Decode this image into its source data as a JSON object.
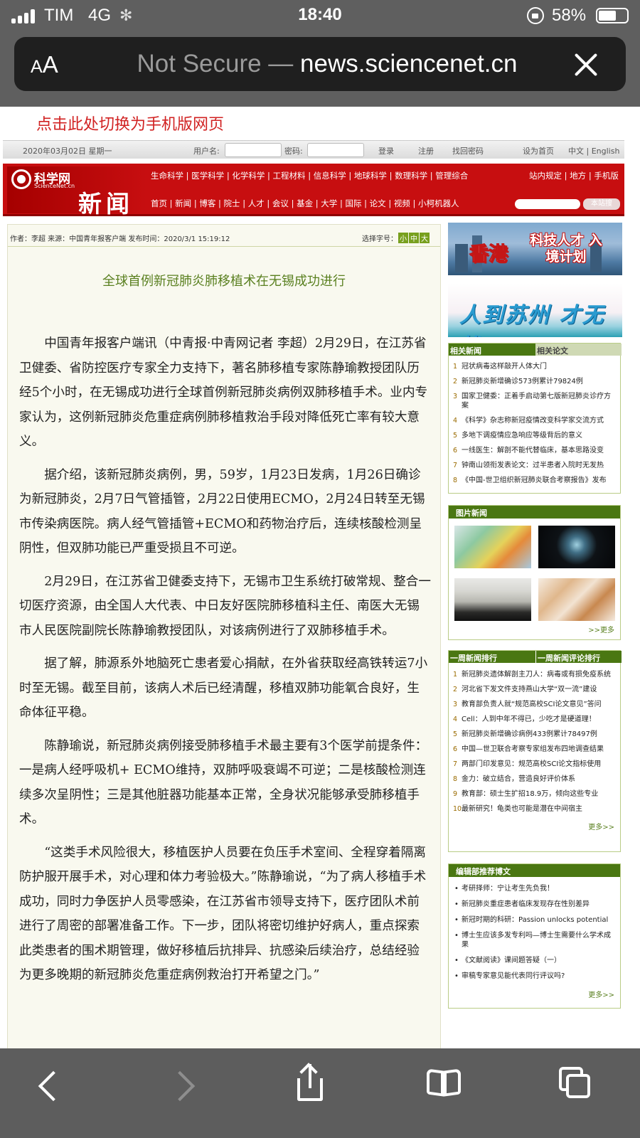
{
  "status": {
    "carrier": "TIM",
    "network": "4G",
    "time": "18:40",
    "battery": "58%"
  },
  "browser": {
    "text_size": "AA",
    "not_secure": "Not Secure —",
    "domain": "news.sciencenet.cn"
  },
  "switch_link": "点击此处切换为手机版网页",
  "topbar": {
    "date": "2020年03月02日 星期一",
    "username_label": "用户名:",
    "password_label": "密码:",
    "login": "登录",
    "register": "注册",
    "recover": "找回密码",
    "set_home": "设为首页",
    "lang": "中文 | English"
  },
  "banner": {
    "logo_cn": "科学网",
    "logo_en": "ScienceNet.cn",
    "section": "新闻",
    "nav_primary": "生命科学 | 医学科学 | 化学科学 | 工程材料 | 信息科学 | 地球科学 | 数理科学 | 管理综合",
    "nav_secondary": "首页 | 新闻 | 博客 | 院士 | 人才 | 会议 | 基金 | 大学 | 国际 | 论文 | 视频 | 小柯机器人",
    "nav_right": "站内规定 | 地方 | 手机版",
    "search_button": "本站搜"
  },
  "article": {
    "meta": "作者：李超 来源：中国青年报客户端 发布时间：2020/3/1 15:19:12",
    "font_label": "选择字号：",
    "font_small": "小",
    "font_mid": "中",
    "font_large": "大",
    "title": "全球首例新冠肺炎肺移植术在无锡成功进行",
    "paragraphs": [
      "中国青年报客户端讯（中青报·中青网记者 李超）2月29日，在江苏省卫健委、省防控医疗专家全力支持下，著名肺移植专家陈静瑜教授团队历经5个小时，在无锡成功进行全球首例新冠肺炎病例双肺移植手术。业内专家认为，这例新冠肺炎危重症病例肺移植救治手段对降低死亡率有较大意义。",
      "据介绍，该新冠肺炎病例，男，59岁，1月23日发病，1月26日确诊为新冠肺炎，2月7日气管插管，2月22日使用ECMO，2月24日转至无锡市传染病医院。病人经气管插管+ECMO和药物治疗后，连续核酸检测呈阴性，但双肺功能已严重受损且不可逆。",
      "2月29日，在江苏省卫健委支持下，无锡市卫生系统打破常规、整合一切医疗资源，由全国人大代表、中日友好医院肺移植科主任、南医大无锡市人民医院副院长陈静瑜教授团队，对该病例进行了双肺移植手术。",
      "据了解，肺源系外地脑死亡患者爱心捐献，在外省获取经高铁转运7小时至无锡。截至目前，该病人术后已经清醒，移植双肺功能氧合良好，生命体征平稳。",
      "陈静瑜说，新冠肺炎病例接受肺移植手术最主要有3个医学前提条件：一是病人经呼吸机+ ECMO维持，双肺呼吸衰竭不可逆；二是核酸检测连续多次呈阴性；三是其他脏器功能基本正常，全身状况能够承受肺移植手术。",
      "“这类手术风险很大，移植医护人员要在负压手术室间、全程穿着隔离防护服开展手术，对心理和体力考验极大。”陈静瑜说，“为了病人移植手术成功，同时力争医护人员零感染，在江苏省市领导支持下，医疗团队术前进行了周密的部署准备工作。下一步，团队将密切维护好病人，重点探索此类患者的围术期管理，做好移植后抗排异、抗感染后续治疗，总结经验为更多晚期的新冠肺炎危重症病例救治打开希望之门。”"
    ]
  },
  "ads": {
    "hk_place": "香港",
    "hk_text": "科技人才 入境计划",
    "js_text": "人到苏州 才无忧"
  },
  "related": {
    "tab_news": "相关新闻",
    "tab_papers": "相关论文",
    "items": [
      "冠状病毒这样敲开人体大门",
      "新冠肺炎新增确诊573例累计79824例",
      "国家卫健委：正着手启动第七版新冠肺炎诊疗方案",
      "《科学》杂志称新冠疫情改变科学家交流方式",
      "多地下调疫情应急响应等级背后的意义",
      "一线医生：解剖不能代替临床，基本思路没变",
      "钟南山领衔发表论文：过半患者入院时无发热",
      "《中国-世卫组织新冠肺炎联合考察报告》发布"
    ]
  },
  "photo_news": {
    "title": "图片新闻",
    "more": ">>更多"
  },
  "weekly": {
    "tab_rank": "一周新闻排行",
    "tab_comments": "一周新闻评论排行",
    "items": [
      "新冠肺炎遗体解剖主刀人：病毒或有损免疫系统",
      "河北省下发文件支持燕山大学“双一流”建设",
      "教育部负责人就“规范高校SCI论文意见”答问",
      "Cell：人到中年不得已，少吃才是硬道理！",
      "新冠肺炎新增确诊病例433例累计78497例",
      "中国—世卫联合考察专家组发布四地调查结果",
      "两部门印发意见：规范高校SCI论文指标使用",
      "金力：破立结合，营造良好评价体系",
      "教育部：硕士生扩招18.9万，倾向这些专业",
      "最新研究！龟类也可能是潜在中间宿主"
    ],
    "more": "更多>>"
  },
  "editor_picks": {
    "title": "编辑部推荐博文",
    "items": [
      "考研择师：宁让考生先负我！",
      "新冠肺炎重症患者临床发现存在性别差异",
      "新冠时期的科研：Passion unlocks potential",
      "博士生应该多发专利吗—博士生需要什么学术成果",
      "《文献阅读》课间题答疑（一）",
      "审稿专家意见能代表同行评议吗?"
    ],
    "more": "更多>>"
  },
  "colors": {
    "brand_red": "#c70e10",
    "green": "#4a7712",
    "headline_green": "#5a8020"
  }
}
